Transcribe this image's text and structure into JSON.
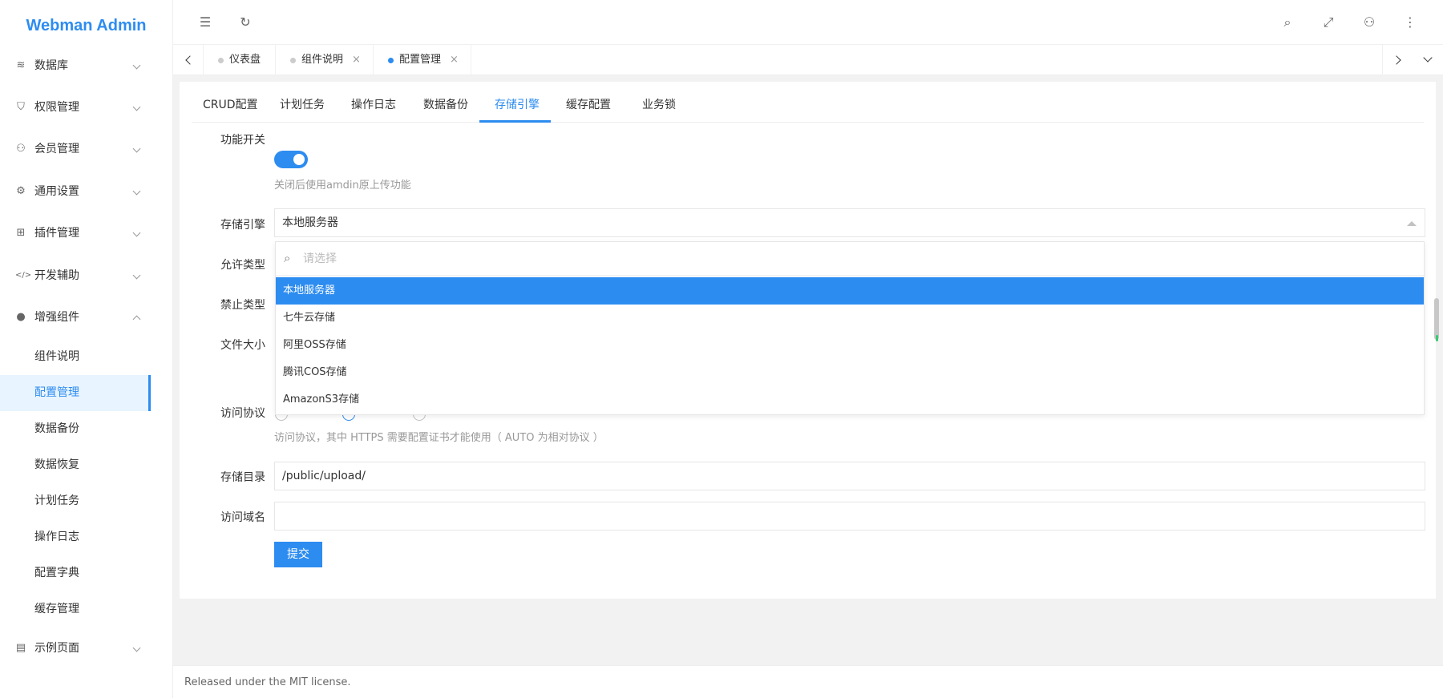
{
  "app": {
    "title": "Webman Admin"
  },
  "sidebar": {
    "items": [
      {
        "label": "数据库",
        "icon": "database-icon"
      },
      {
        "label": "权限管理",
        "icon": "shield-icon"
      },
      {
        "label": "会员管理",
        "icon": "user-icon"
      },
      {
        "label": "通用设置",
        "icon": "gear-icon"
      },
      {
        "label": "插件管理",
        "icon": "plugin-icon"
      },
      {
        "label": "开发辅助",
        "icon": "code-icon"
      },
      {
        "label": "增强组件",
        "icon": "compass-icon"
      }
    ],
    "sub_items": [
      "组件说明",
      "配置管理",
      "数据备份",
      "数据恢复",
      "计划任务",
      "操作日志",
      "配置字典",
      "缓存管理"
    ],
    "last_item": {
      "label": "示例页面",
      "icon": "pages-icon"
    }
  },
  "header": {
    "icons": [
      "menu-fold-icon",
      "refresh-icon",
      "search-icon",
      "fullscreen-icon",
      "user-icon",
      "more-icon"
    ]
  },
  "page_tabs": [
    {
      "label": "仪表盘"
    },
    {
      "label": "组件说明",
      "close": "×"
    },
    {
      "label": "配置管理",
      "close": "×"
    }
  ],
  "config_tabs": [
    "CRUD配置",
    "计划任务",
    "操作日志",
    "数据备份",
    "存储引擎",
    "缓存配置",
    "业务锁"
  ],
  "form": {
    "switch_label": "功能开关",
    "switch_hint": "关闭后使用amdin原上传功能",
    "engine_label": "存储引擎",
    "engine_value": "本地服务器",
    "allow_label": "允许类型",
    "deny_label": "禁止类型",
    "size_label": "文件大小",
    "protocol_label": "访问协议",
    "protocol_hint": "访问协议，其中 HTTPS 需要配置证书才能使用（ AUTO 为相对协议 ）",
    "dir_label": "存储目录",
    "dir_value": "/public/upload/",
    "domain_label": "访问域名",
    "domain_value": "",
    "submit": "提交"
  },
  "dropdown": {
    "placeholder": "请选择",
    "options": [
      "本地服务器",
      "七牛云存储",
      "阿里OSS存储",
      "腾讯COS存储",
      "AmazonS3存储"
    ],
    "selected": "本地服务器"
  },
  "footer": {
    "text": "Released under the MIT license."
  },
  "colors": {
    "accent": "#2d8cf0",
    "scroll_indicator": "#3cc873"
  }
}
